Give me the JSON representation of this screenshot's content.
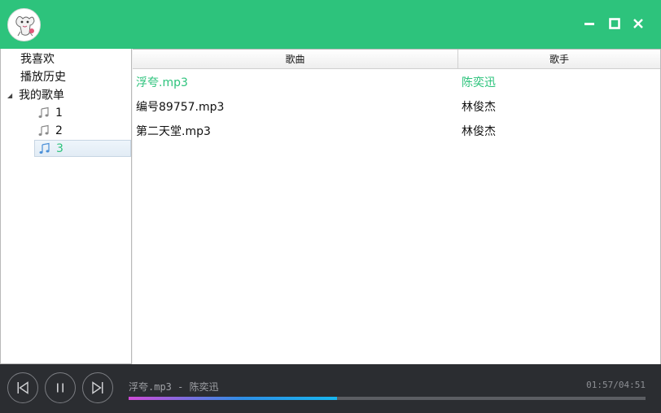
{
  "window": {
    "accent_color": "#2dc37c",
    "controls": [
      "minimize-icon",
      "maximize-icon",
      "close-icon"
    ]
  },
  "sidebar": {
    "favorites": "我喜欢",
    "history": "播放历史",
    "my_playlists": "我的歌单",
    "playlists": [
      {
        "label": "1",
        "icon": "music-note-icon"
      },
      {
        "label": "2",
        "icon": "music-note-icon"
      },
      {
        "label": "3",
        "icon": "music-note-icon",
        "selected": true
      }
    ]
  },
  "table": {
    "headers": {
      "song": "歌曲",
      "artist": "歌手"
    },
    "rows": [
      {
        "song": "浮夸.mp3",
        "artist": "陈奕迅",
        "playing": true
      },
      {
        "song": "编号89757.mp3",
        "artist": "林俊杰"
      },
      {
        "song": "第二天堂.mp3",
        "artist": "林俊杰"
      }
    ]
  },
  "player": {
    "now_playing": "浮夸.mp3 - 陈奕迅",
    "time": "01:57/04:51",
    "progress": 0.403,
    "controls": [
      "previous-icon",
      "pause-icon",
      "next-icon"
    ]
  }
}
